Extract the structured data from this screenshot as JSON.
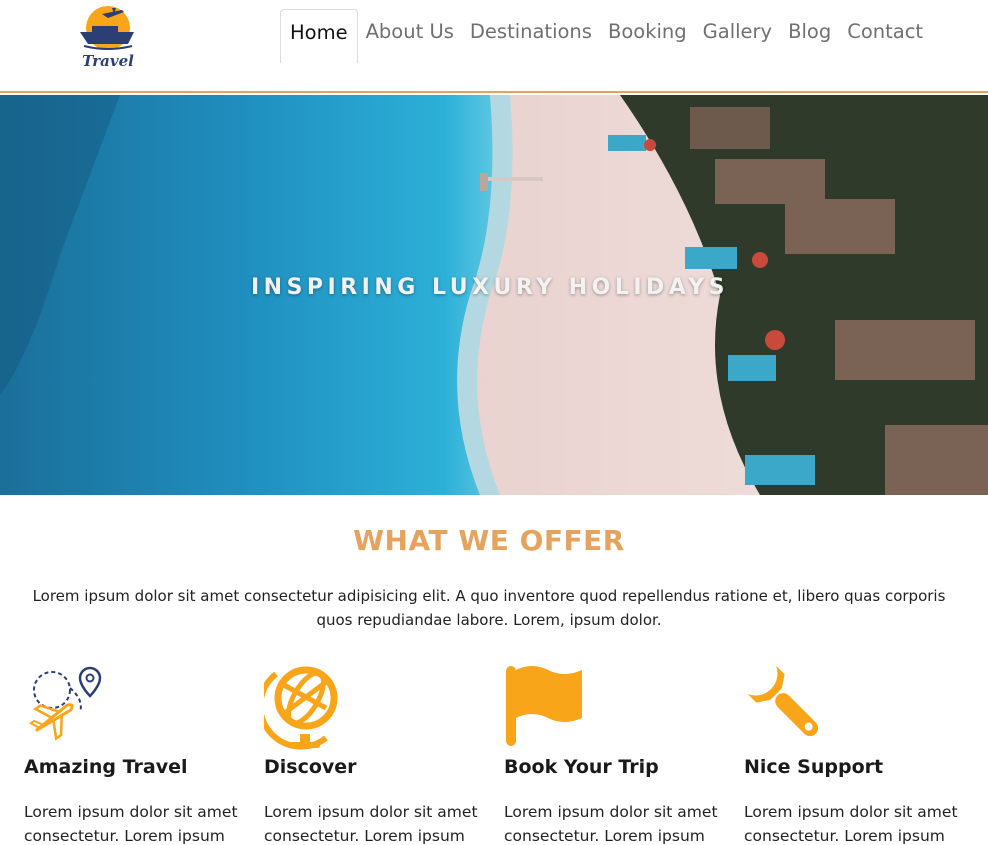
{
  "brand": {
    "logo_text": "Travel",
    "accent": "#e5a35e",
    "icon_orange": "#f9a51a",
    "icon_navy": "#2b3f74"
  },
  "nav": {
    "items": [
      {
        "label": "Home",
        "active": true
      },
      {
        "label": "About Us"
      },
      {
        "label": "Destinations"
      },
      {
        "label": "Booking"
      },
      {
        "label": "Gallery"
      },
      {
        "label": "Blog"
      },
      {
        "label": "Contact"
      }
    ]
  },
  "hero": {
    "headline": "INSPIRING LUXURY HOLIDAYS"
  },
  "offer": {
    "title": "WHAT WE OFFER",
    "description": "Lorem ipsum dolor sit amet consectetur adipisicing elit. A quo inventore quod repellendus ratione et, libero quas corporis quos repudiandae labore. Lorem, ipsum dolor.",
    "features": [
      {
        "title": "Amazing Travel",
        "text": "Lorem ipsum dolor sit amet consectetur. Lorem ipsum",
        "icon": "plane-route-icon"
      },
      {
        "title": "Discover",
        "text": "Lorem ipsum dolor sit amet consectetur. Lorem ipsum",
        "icon": "globe-icon"
      },
      {
        "title": "Book Your Trip",
        "text": "Lorem ipsum dolor sit amet consectetur. Lorem ipsum",
        "icon": "flag-icon"
      },
      {
        "title": "Nice Support",
        "text": "Lorem ipsum dolor sit amet consectetur. Lorem ipsum",
        "icon": "wrench-icon"
      }
    ]
  }
}
